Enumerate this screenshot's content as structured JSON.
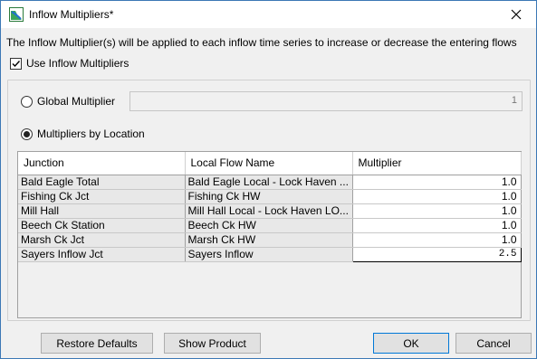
{
  "window": {
    "title": "Inflow Multipliers*"
  },
  "description": "The Inflow Multiplier(s) will be applied to each inflow time series to increase or decrease the entering flows",
  "use_checkbox": {
    "label": "Use Inflow Multipliers",
    "checked": true
  },
  "global": {
    "label": "Global Multiplier",
    "value": "1",
    "selected": false
  },
  "by_location": {
    "label": "Multipliers by Location",
    "selected": true
  },
  "table": {
    "headers": [
      "Junction",
      "Local Flow Name",
      "Multiplier"
    ],
    "rows": [
      {
        "junction": "Bald Eagle Total",
        "local": "Bald Eagle Local - Lock Haven ...",
        "multiplier": "1.0"
      },
      {
        "junction": "Fishing Ck Jct",
        "local": "Fishing Ck HW",
        "multiplier": "1.0"
      },
      {
        "junction": "Mill Hall",
        "local": "Mill Hall Local - Lock Haven LO...",
        "multiplier": "1.0"
      },
      {
        "junction": "Beech Ck Station",
        "local": "Beech Ck HW",
        "multiplier": "1.0"
      },
      {
        "junction": "Marsh Ck Jct",
        "local": "Marsh Ck HW",
        "multiplier": "1.0"
      },
      {
        "junction": "Sayers Inflow Jct",
        "local": "Sayers Inflow",
        "multiplier": "2.5"
      }
    ]
  },
  "buttons": {
    "restore": "Restore Defaults",
    "show_product": "Show Product",
    "ok": "OK",
    "cancel": "Cancel"
  }
}
